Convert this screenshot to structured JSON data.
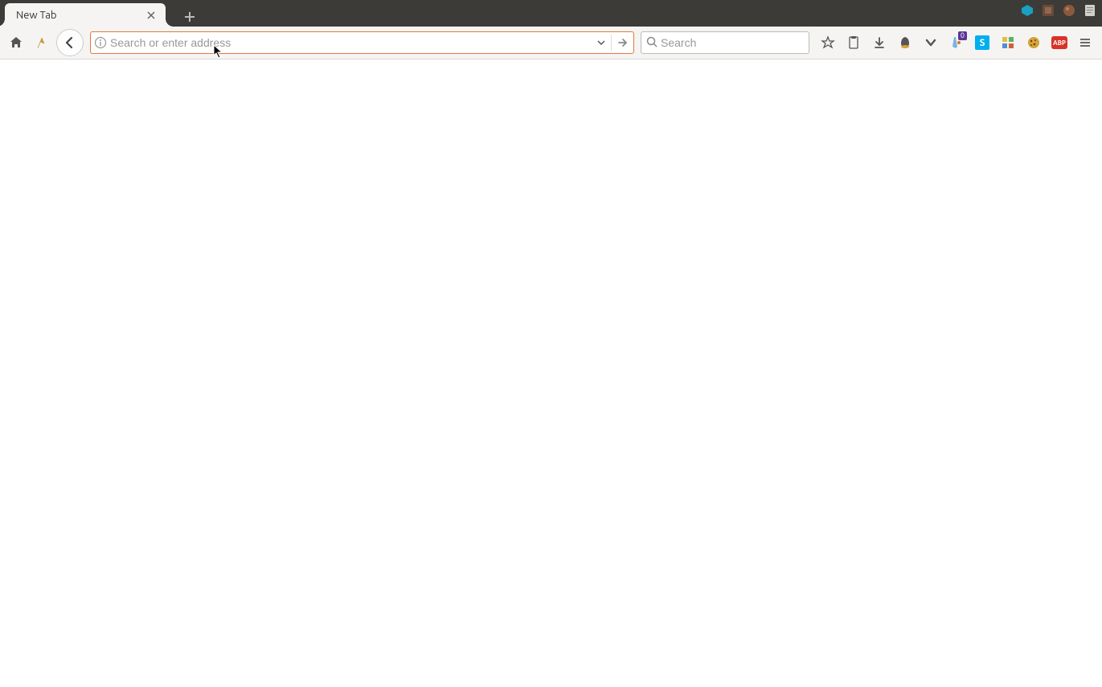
{
  "tabs": [
    {
      "title": "New Tab"
    }
  ],
  "urlbar": {
    "placeholder": "Search or enter address",
    "value": ""
  },
  "searchbar": {
    "placeholder": "Search",
    "value": ""
  },
  "badge_count": "0",
  "skype_letter": "S",
  "abp_label": "ABP"
}
